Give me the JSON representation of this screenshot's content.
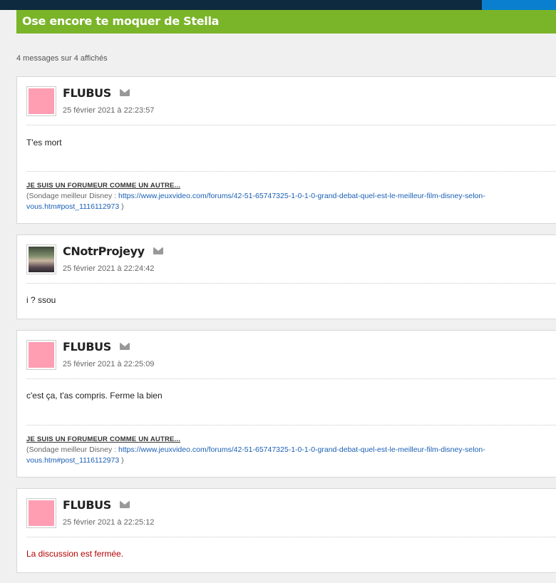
{
  "topic": {
    "title": "Ose encore te moquer de Stella"
  },
  "count_text": "4 messages sur 4 affichés",
  "posts": [
    {
      "author": "FLUBUS",
      "date": "25 février 2021 à 22:23:57",
      "text": "T'es mort",
      "signature": {
        "heading": "JE SUIS UN FORUMEUR COMME UN AUTRE...",
        "prefix": "(Sondage meilleur Disney : ",
        "link": "https://www.jeuxvideo.com/forums/42-51-65747325-1-0-1-0-grand-debat-quel-est-le-meilleur-film-disney-selon-vous.htm#post_1116112973",
        "suffix": " )"
      }
    },
    {
      "author": "CNotrProjeyy",
      "date": "25 février 2021 à 22:24:42",
      "text": "i ? ssou"
    },
    {
      "author": "FLUBUS",
      "date": "25 février 2021 à 22:25:09",
      "text": "c'est ça, t'as compris. Ferme la bien",
      "signature": {
        "heading": "JE SUIS UN FORUMEUR COMME UN AUTRE...",
        "prefix": "(Sondage meilleur Disney : ",
        "link": "https://www.jeuxvideo.com/forums/42-51-65747325-1-0-1-0-grand-debat-quel-est-le-meilleur-film-disney-selon-vous.htm#post_1116112973",
        "suffix": " )"
      }
    },
    {
      "author": "FLUBUS",
      "date": "25 février 2021 à 22:25:12",
      "text": "La discussion est fermée."
    }
  ],
  "icons": {
    "message": "mail-icon",
    "avatar": "avatar-image"
  },
  "colors": {
    "title_bar": "#7ab428",
    "topbar": "#0e2a3e",
    "accent": "#0a7fcf",
    "link": "#1a5fb4",
    "closed": "#b30000",
    "avatar_placeholder": "#ff9eb3"
  }
}
